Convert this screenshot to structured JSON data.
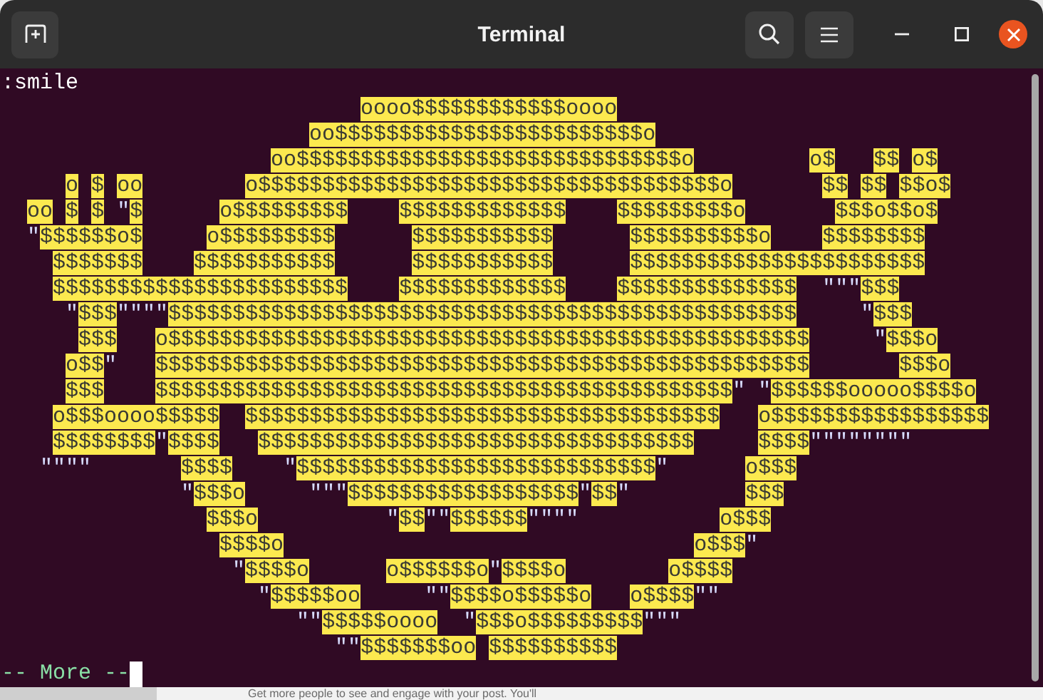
{
  "window": {
    "title": "Terminal"
  },
  "terminal": {
    "command": ":smile",
    "art_lines": [
      [
        "                            oooo$$$$$$$$$$$$oooo"
      ],
      [
        "                        oo$$$$$$$$$$$$$$$$$$$$$$$$o"
      ],
      [
        "                     oo$$$$$$$$$$$$$$$$$$$$$$$$$$$$$$o",
        "         o$",
        "   $$ o$"
      ],
      [
        "     o $ oo",
        "        o$$$$$$$$$$$$$$$$$$$$$$$$$$$$$$$$$$$$o",
        "       $$ $$ $$o$"
      ],
      [
        "  oo $ $ \"$",
        "      o$$$$$$$$$",
        "    $$$$$$$$$$$$$",
        "    $$$$$$$$$o",
        "       $$$o$$o$"
      ],
      [
        "  \"$$$$$$o$",
        "     o$$$$$$$$$",
        "      $$$$$$$$$$$",
        "      $$$$$$$$$$o",
        "    $$$$$$$$"
      ],
      [
        "    $$$$$$$",
        "    $$$$$$$$$$$",
        "      $$$$$$$$$$$",
        "      $$$$$$$$$$$$$$$$$$$$$$$"
      ],
      [
        "    $$$$$$$$$$$$$$$$$$$$$$$",
        "    $$$$$$$$$$$$$",
        "    $$$$$$$$$$$$$$  \"\"\"$$$"
      ],
      [
        "     \"$$$\"\"\"\"$$$$$$$$$$$$$$$$$$$$$$$$$$$$$$$$$$$$$$$$$$$$$$$$$",
        "     \"$$$"
      ],
      [
        "      $$$",
        "   o$$$$$$$$$$$$$$$$$$$$$$$$$$$$$$$$$$$$$$$$$$$$$$$$$$",
        "     \"$$$o"
      ],
      [
        "     o$$\"",
        "   $$$$$$$$$$$$$$$$$$$$$$$$$$$$$$$$$$$$$$$$$$$$$$$$$$$",
        "       $$$o"
      ],
      [
        "     $$$",
        "    $$$$$$$$$$$$$$$$$$$$$$$$$$$$$$$$$$$$$$$$$$$$$\" \"$$$$$$ooooo$$$$o"
      ],
      [
        "    o$$$oooo$$$$$  $$$$$$$$$$$$$$$$$$$$$$$$$$$$$$$$$$$$$",
        "   o$$$$$$$$$$$$$$$$$"
      ],
      [
        "    $$$$$$$$\"$$$$",
        "   $$$$$$$$$$$$$$$$$$$$$$$$$$$$$$$$$$",
        "     $$$$\"\"\"\"\"\"\"\""
      ],
      [
        "   \"\"\"\"",
        "       $$$$",
        "    \"$$$$$$$$$$$$$$$$$$$$$$$$$$$$\"",
        "      o$$$"
      ],
      [
        "              \"$$$o",
        "     \"\"\"$$$$$$$$$$$$$$$$$$\"$$\"",
        "         $$$"
      ],
      [
        "                $$$o",
        "          \"$$\"\"$$$$$$\"\"\"\"",
        "           o$$$"
      ],
      [
        "                 $$$$o",
        "                                o$$$\""
      ],
      [
        "                  \"$$$$o",
        "      o$$$$$$o\"$$$$o",
        "        o$$$$"
      ],
      [
        "                    \"$$$$$oo",
        "     \"\"$$$$o$$$$$o",
        "   o$$$$\"\""
      ],
      [
        "                       \"\"$$$$$oooo  \"$$$o$$$$$$$$$\"\"\""
      ],
      [
        "                          \"\"$$$$$$$oo $$$$$$$$$$"
      ]
    ],
    "pager_prompt": "-- More --"
  },
  "background_window": {
    "text": "Get more people to see and engage with your post. You'll"
  }
}
